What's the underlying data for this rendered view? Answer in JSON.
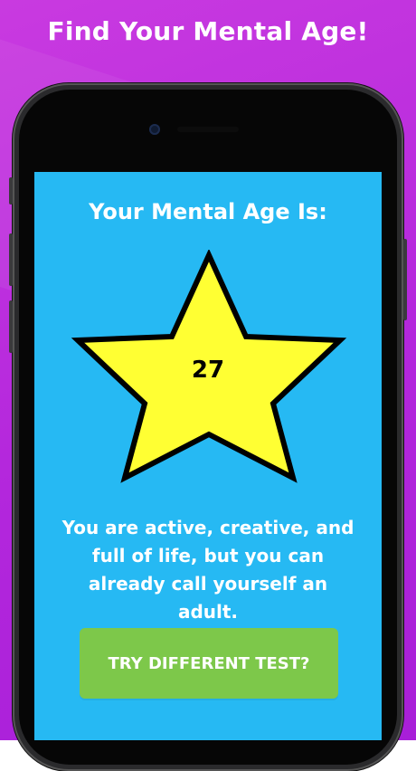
{
  "promo": {
    "headline": "Find Your Mental Age!"
  },
  "result": {
    "title": "Your Mental Age Is:",
    "age": "27",
    "description": "You are active, creative, and full of life, but you can already call yourself an adult."
  },
  "actions": {
    "try_different_label": "TRY DIFFERENT TEST?"
  },
  "colors": {
    "background": "#b52adc",
    "screen": "#26b9f3",
    "star_fill": "#ffff33",
    "button": "#7dc84a"
  }
}
